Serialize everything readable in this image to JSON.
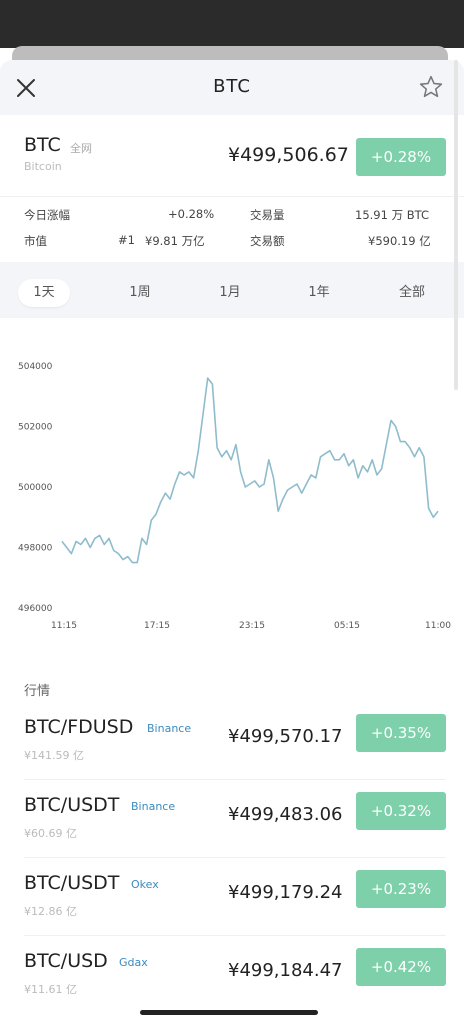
{
  "header": {
    "title": "BTC"
  },
  "coin": {
    "symbol": "BTC",
    "market": "全网",
    "name": "Bitcoin",
    "price": "¥499,506.67",
    "change": "+0.28%"
  },
  "stats": {
    "today_change_label": "今日涨幅",
    "today_change_value": "+0.28%",
    "volume_label": "交易量",
    "volume_value": "15.91 万 BTC",
    "market_cap_label": "市值",
    "market_cap_rank": "#1",
    "market_cap_value": "¥9.81 万亿",
    "turnover_label": "交易额",
    "turnover_value": "¥590.19 亿"
  },
  "tabs": [
    "1天",
    "1周",
    "1月",
    "1年",
    "全部"
  ],
  "chart_data": {
    "type": "line",
    "x_ticks": [
      "11:15",
      "17:15",
      "23:15",
      "05:15",
      "11:00"
    ],
    "y_ticks": [
      "504000",
      "502000",
      "500000",
      "498000",
      "496000"
    ],
    "ylim": [
      496000,
      504000
    ],
    "line_color": "#8fbccc",
    "values": [
      498200,
      498000,
      497800,
      498200,
      498100,
      498300,
      498000,
      498300,
      498400,
      498100,
      498300,
      497900,
      497800,
      497600,
      497700,
      497500,
      497500,
      498300,
      498100,
      498900,
      499100,
      499500,
      499800,
      499600,
      500100,
      500500,
      500400,
      500500,
      500300,
      501200,
      502400,
      503600,
      503400,
      501300,
      501000,
      501200,
      500900,
      501400,
      500500,
      500000,
      500100,
      500200,
      500000,
      500100,
      500900,
      500300,
      499200,
      499600,
      499900,
      500000,
      500100,
      499800,
      500100,
      500400,
      500300,
      501000,
      501100,
      501200,
      500900,
      500900,
      501100,
      500700,
      500900,
      500300,
      500700,
      500500,
      500900,
      500400,
      500600,
      501400,
      502200,
      502000,
      501500,
      501500,
      501300,
      501000,
      501300,
      501000,
      499300,
      499000,
      499200
    ]
  },
  "market_section_title": "行情",
  "markets": [
    {
      "pair": "BTC/FDUSD",
      "exchange": "Binance",
      "volume": "¥141.59 亿",
      "price": "¥499,570.17",
      "change": "+0.35%"
    },
    {
      "pair": "BTC/USDT",
      "exchange": "Binance",
      "volume": "¥60.69 亿",
      "price": "¥499,483.06",
      "change": "+0.32%"
    },
    {
      "pair": "BTC/USDT",
      "exchange": "Okex",
      "volume": "¥12.86 亿",
      "price": "¥499,179.24",
      "change": "+0.23%"
    },
    {
      "pair": "BTC/USD",
      "exchange": "Gdax",
      "volume": "¥11.61 亿",
      "price": "¥499,184.47",
      "change": "+0.42%"
    }
  ],
  "colors": {
    "up": "#7dd0a9",
    "exchange": "#3a8bbf"
  }
}
